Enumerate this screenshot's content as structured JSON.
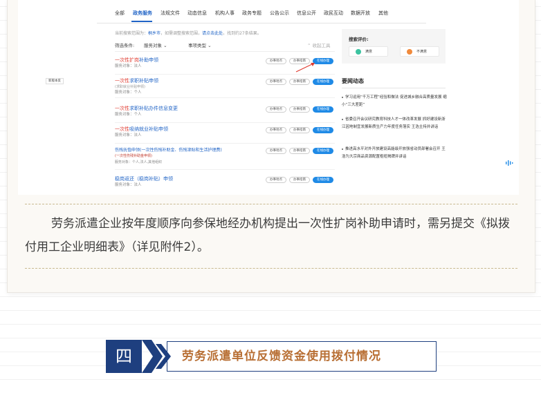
{
  "screenshot": {
    "nav": [
      {
        "label": "全部",
        "active": false
      },
      {
        "label": "政务服务",
        "active": true
      },
      {
        "label": "法规文件",
        "active": false
      },
      {
        "label": "动态信息",
        "active": false
      },
      {
        "label": "机构人事",
        "active": false
      },
      {
        "label": "政务专题",
        "active": false
      },
      {
        "label": "公告公示",
        "active": false
      },
      {
        "label": "信息公开",
        "active": false
      },
      {
        "label": "政民互动",
        "active": false
      },
      {
        "label": "数据开放",
        "active": false
      },
      {
        "label": "其他",
        "active": false
      }
    ],
    "hint": {
      "prefix": "当前搜索范围为：",
      "scope": "桐乡市",
      "middle": "，如需调整搜索范围，",
      "link": "请点击此处",
      "suffix": "。找到约27条结果。"
    },
    "filter": {
      "label": "筛选条件:",
      "object": "服务对象",
      "type": "事项类型",
      "collapse": "收起工具"
    },
    "side_tag": "新版本反",
    "services": [
      {
        "title_red": "一次性扩岗",
        "title_blue": "补助申领",
        "sub": "",
        "meta": "服务对象：法人",
        "buttons": [
          "办事地点",
          "办事指南"
        ],
        "primary": "在线办理"
      },
      {
        "title_red": "一次性",
        "title_blue": "求职补贴申领",
        "sub": "(求职就业补贴申领)",
        "meta": "服务对象：个人",
        "buttons": [
          "办事地点",
          "办事指南"
        ],
        "primary": "在线办理"
      },
      {
        "title_red": "一次性",
        "title_blue": "求职补贴办件信息变更",
        "sub": "",
        "meta": "服务对象：个人",
        "buttons": [
          "办事地点",
          "办事指南"
        ],
        "primary": "在线办理"
      },
      {
        "title_red": "一次性",
        "title_blue": "吸纳就业补贴申领",
        "sub": "",
        "meta": "服务对象：法人",
        "buttons": [
          "办事地点",
          "办事指南"
        ],
        "primary": "在线办理"
      },
      {
        "title_red": "",
        "title_blue": "伤残抚恤申领(一次性伤残补助金、伤残津贴和生活护理费)",
        "sub": "(一次性伤残补助金申领)",
        "meta": "服务对象：个人,法人,其他组织",
        "buttons": [
          "办事地点",
          "办事指南"
        ],
        "primary": "在线办理"
      },
      {
        "title_red": "",
        "title_blue": "稳岗返还（稳岗补贴）申领",
        "sub": "",
        "meta": "服务对象：法人",
        "buttons": [
          "办事地点",
          "办事指南"
        ],
        "primary": "在线办理"
      }
    ],
    "evaluation": {
      "title": "搜索评价:",
      "satisfied": "满意",
      "unsatisfied": "不满意",
      "satisfied_color": "#3cc3a0",
      "unsatisfied_color": "#f08a3c"
    },
    "news": {
      "title": "要闻动态",
      "items": [
        "学习运用“千万工程”经验和做法 促进城乡融合高质量发展 缩小“三大差距”",
        "省委召开会议研究教育科技人才一体改革发展 抓好建设新浙江因地制宜发展新质生产力年度任务落实 王浩主持并讲话",
        "推进高水平对外开放建设高能级开放强省动员部署会召开 王浩为大宗商品资源配置枢纽揭牌并讲话"
      ]
    }
  },
  "article": {
    "paragraph": "劳务派遣企业按年度顺序向参保地经办机构提出一次性扩岗补助申请时，需另提交《拟拨付用工企业明细表》（详见附件2）。"
  },
  "section": {
    "number": "四",
    "title": "劳务派遣单位反馈资金使用拨付情况"
  },
  "colors": {
    "primary_blue": "#1f63c6",
    "highlight_red": "#e03c31",
    "banner_navy": "#1e3f7f",
    "banner_text": "#b86f34"
  }
}
